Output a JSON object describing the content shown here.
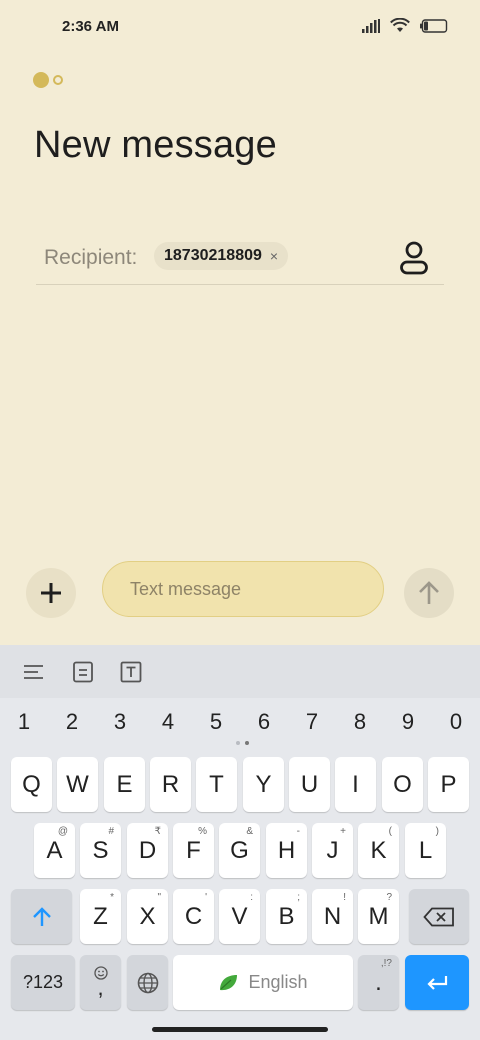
{
  "status_bar": {
    "time": "2:36 AM"
  },
  "header": {
    "title": "New message"
  },
  "recipient": {
    "label": "Recipient:",
    "chip_number": "18730218809",
    "chip_remove": "×"
  },
  "compose": {
    "placeholder": "Text message"
  },
  "keyboard": {
    "numbers": [
      "1",
      "2",
      "3",
      "4",
      "5",
      "6",
      "7",
      "8",
      "9",
      "0"
    ],
    "row1": [
      "Q",
      "W",
      "E",
      "R",
      "T",
      "Y",
      "U",
      "I",
      "O",
      "P"
    ],
    "row2": [
      {
        "k": "A",
        "h": "@"
      },
      {
        "k": "S",
        "h": "#"
      },
      {
        "k": "D",
        "h": "₹"
      },
      {
        "k": "F",
        "h": "%"
      },
      {
        "k": "G",
        "h": "&"
      },
      {
        "k": "H",
        "h": "-"
      },
      {
        "k": "J",
        "h": "+"
      },
      {
        "k": "K",
        "h": "("
      },
      {
        "k": "L",
        "h": ")"
      }
    ],
    "row3": [
      {
        "k": "Z",
        "h": "*"
      },
      {
        "k": "X",
        "h": "\""
      },
      {
        "k": "C",
        "h": "'"
      },
      {
        "k": "V",
        "h": ":"
      },
      {
        "k": "B",
        "h": ";"
      },
      {
        "k": "N",
        "h": "!"
      },
      {
        "k": "M",
        "h": "?"
      }
    ],
    "symbols_label": "?123",
    "comma_label": ",",
    "space_label": "English",
    "period_label": ".",
    "period_hint": ",!?"
  },
  "colors": {
    "background": "#f3ecd5",
    "accent": "#1e96ff",
    "input_bg": "#f1e3ad"
  }
}
